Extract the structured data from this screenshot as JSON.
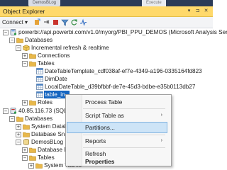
{
  "window_strip": {
    "tab_label": "DemosBLog",
    "execute_label": "Execute"
  },
  "panel": {
    "title": "Object Explorer",
    "pin_glyph": "▾",
    "pushpin_glyph": "⊐",
    "close_glyph": "✕"
  },
  "toolbar": {
    "connect_label": "Connect",
    "connect_dropdown": "▾"
  },
  "tree": {
    "server1": "powerbi://api.powerbi.com/v1.0/myorg/PBI_PPU_DEMOS (Microsoft Analysis Server",
    "databases": "Databases",
    "db_incremental": "Incremental refresh & realtime",
    "connections": "Connections",
    "tables": "Tables",
    "table1": "DateTableTemplate_cdf038af-ef7e-4349-a196-0335164fd823",
    "table2": "DimDate",
    "table3": "LocalDateTable_d39bfbbf-de7e-45d3-bdbe-e35b0113db27",
    "table_selected": "table_in",
    "roles": "Roles",
    "server2": "40.85.116.73 (SQL Serv",
    "databases2": "Databases",
    "system_databases": "System Databa",
    "database_snapshots": "Database Snaps",
    "demosblog": "DemosBLog",
    "database_diagrams": "Database Di",
    "tables2": "Tables",
    "system_tables": "System Tables"
  },
  "context_menu": {
    "process_table": "Process Table",
    "script_table_as": "Script Table as",
    "partitions": "Partitions...",
    "reports": "Reports",
    "refresh": "Refresh",
    "properties": "Properties",
    "submenu_arrow": "›"
  },
  "colors": {
    "title_bar": "#ffd96b",
    "selection": "#1565c0",
    "menu_highlight": "#cde4f7",
    "folder": "#e8b84a"
  }
}
